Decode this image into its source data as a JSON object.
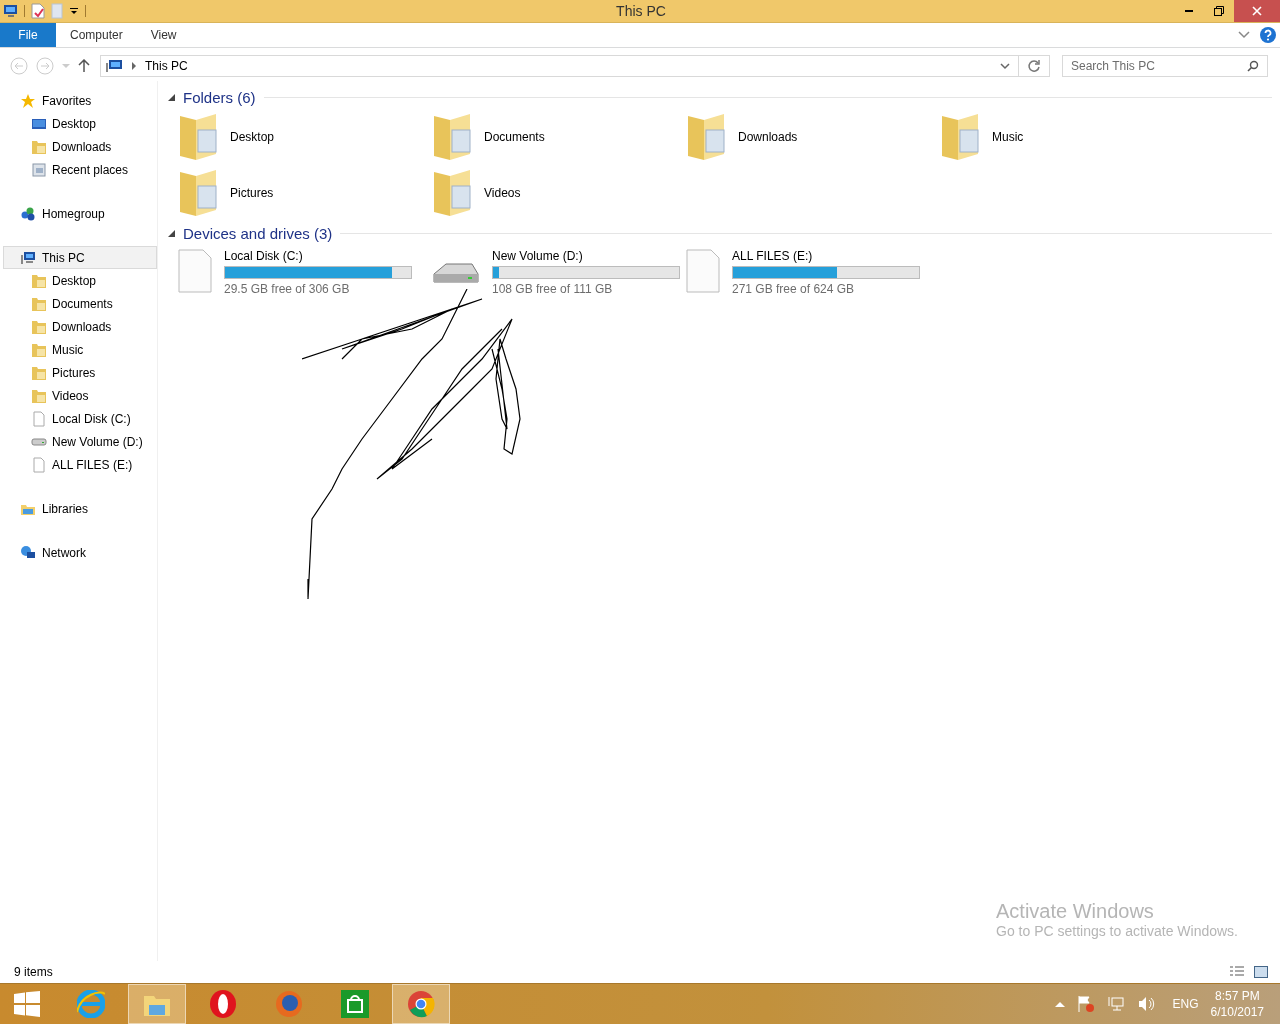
{
  "window": {
    "title": "This PC"
  },
  "ribbon_tabs": [
    {
      "label": "File",
      "selected": true
    },
    {
      "label": "Computer",
      "selected": false
    },
    {
      "label": "View",
      "selected": false
    }
  ],
  "address_bar": {
    "path": "This PC"
  },
  "search": {
    "placeholder": "Search This PC"
  },
  "sidebar": {
    "items": [
      {
        "label": "Favorites",
        "kind": "star",
        "selected": false,
        "children": [
          {
            "label": "Desktop",
            "kind": "desktop",
            "selected": false
          },
          {
            "label": "Downloads",
            "kind": "folder",
            "selected": false
          },
          {
            "label": "Recent places",
            "kind": "recent",
            "selected": false
          }
        ]
      },
      {
        "label": "Homegroup",
        "kind": "homegroup",
        "selected": false
      },
      {
        "label": "This PC",
        "kind": "computer",
        "selected": true,
        "children": [
          {
            "label": "Desktop",
            "kind": "folder",
            "selected": false
          },
          {
            "label": "Documents",
            "kind": "folder",
            "selected": false
          },
          {
            "label": "Downloads",
            "kind": "folder",
            "selected": false
          },
          {
            "label": "Music",
            "kind": "folder",
            "selected": false
          },
          {
            "label": "Pictures",
            "kind": "folder",
            "selected": false
          },
          {
            "label": "Videos",
            "kind": "folder",
            "selected": false
          },
          {
            "label": "Local Disk (C:)",
            "kind": "page",
            "selected": false
          },
          {
            "label": "New Volume (D:)",
            "kind": "drive",
            "selected": false
          },
          {
            "label": "ALL FILES (E:)",
            "kind": "page",
            "selected": false
          }
        ]
      },
      {
        "label": "Libraries",
        "kind": "libraries",
        "selected": false
      },
      {
        "label": "Network",
        "kind": "network",
        "selected": false
      }
    ]
  },
  "folders": {
    "heading": "Folders (6)",
    "items": [
      {
        "name": "Desktop"
      },
      {
        "name": "Documents"
      },
      {
        "name": "Downloads"
      },
      {
        "name": "Music"
      },
      {
        "name": "Pictures"
      },
      {
        "name": "Videos"
      }
    ]
  },
  "drives": {
    "heading": "Devices and drives (3)",
    "items": [
      {
        "name": "Local Disk (C:)",
        "kind": "page",
        "level": 0.9,
        "free": "29.5 GB free of 306 GB"
      },
      {
        "name": "New Volume (D:)",
        "kind": "drive",
        "level": 0.03,
        "free": "108 GB free of 111 GB"
      },
      {
        "name": "ALL FILES (E:)",
        "kind": "page",
        "level": 0.56,
        "free": "271 GB free of 624 GB"
      }
    ]
  },
  "activation_notice": {
    "title": "Activate Windows",
    "text": "Go to PC settings to activate Windows."
  },
  "status_bar": {
    "count": "9 items"
  },
  "taskbar": {
    "apps": [
      {
        "kind": "ie",
        "active": false
      },
      {
        "kind": "explorer",
        "active": true
      },
      {
        "kind": "opera",
        "active": false
      },
      {
        "kind": "firefox",
        "active": false
      },
      {
        "kind": "store",
        "active": false
      },
      {
        "kind": "chrome",
        "active": true
      }
    ],
    "language": "ENG",
    "time": "8:57 PM",
    "date": "6/10/2017"
  }
}
